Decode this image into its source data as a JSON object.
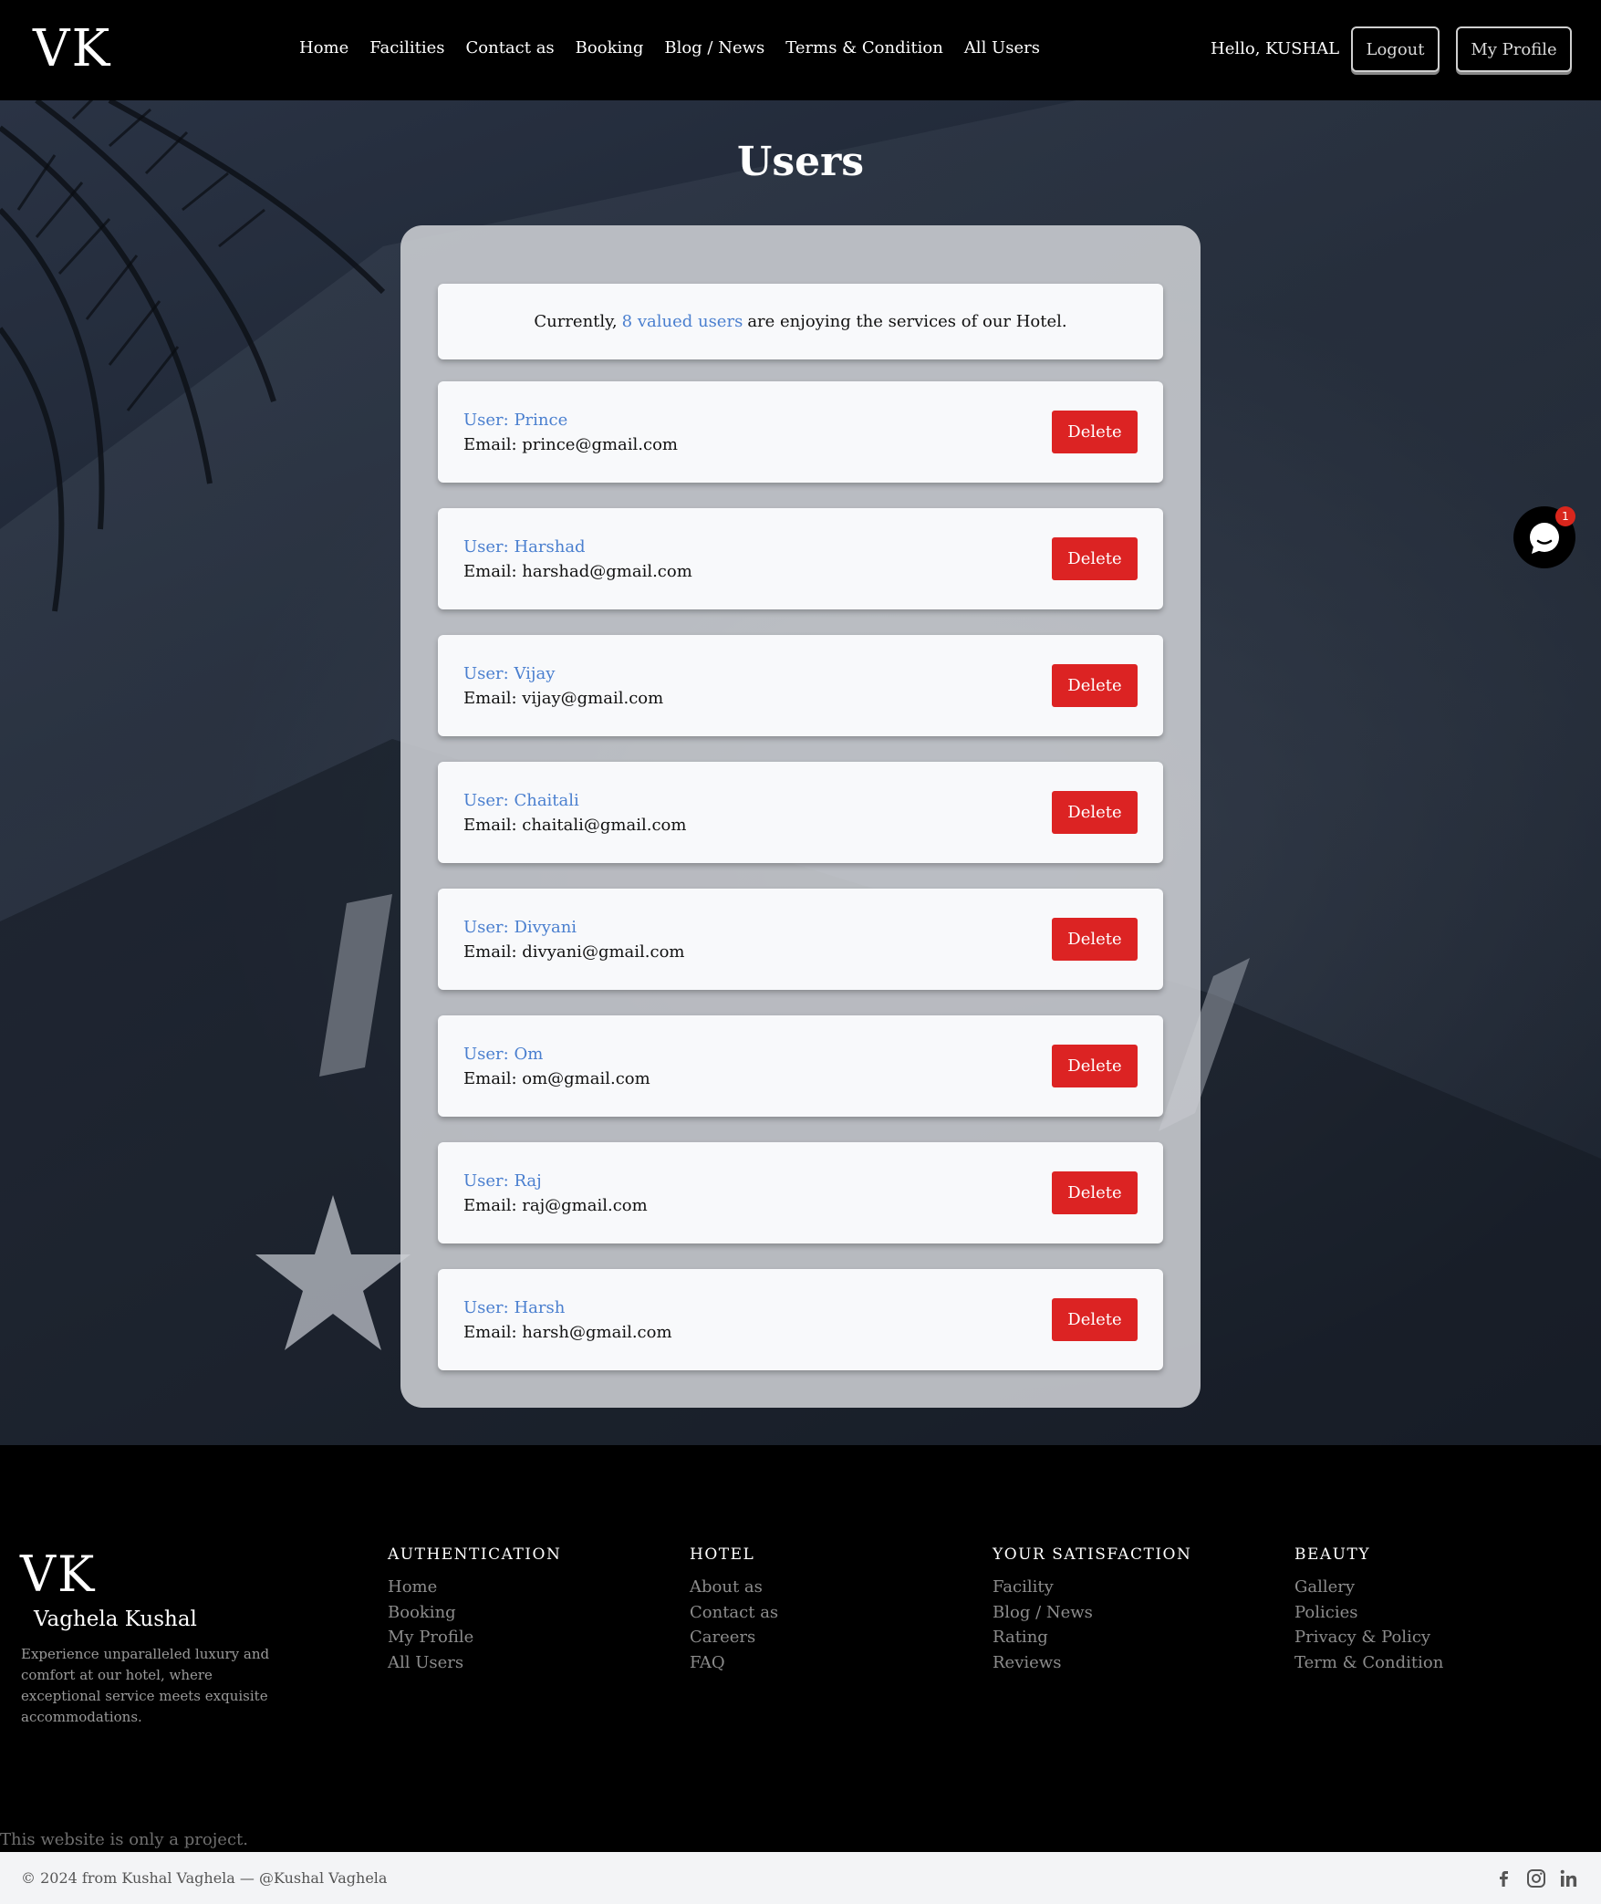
{
  "navbar": {
    "brand": "VK",
    "links": [
      "Home",
      "Facilities",
      "Contact as",
      "Booking",
      "Blog / News",
      "Terms & Condition",
      "All Users"
    ],
    "greeting": "Hello, KUSHAL",
    "logout_label": "Logout",
    "profile_label": "My Profile"
  },
  "main": {
    "title": "Users",
    "summary": {
      "prefix": "Currently,",
      "highlight": "8 valued users",
      "suffix": "are enjoying the services of our Hotel."
    },
    "delete_label": "Delete",
    "users": [
      {
        "name": "User: Prince",
        "email": "Email: prince@gmail.com"
      },
      {
        "name": "User: Harshad",
        "email": "Email: harshad@gmail.com"
      },
      {
        "name": "User: Vijay",
        "email": "Email: vijay@gmail.com"
      },
      {
        "name": "User: Chaitali",
        "email": "Email: chaitali@gmail.com"
      },
      {
        "name": "User: Divyani",
        "email": "Email: divyani@gmail.com"
      },
      {
        "name": "User: Om",
        "email": "Email: om@gmail.com"
      },
      {
        "name": "User: Raj",
        "email": "Email: raj@gmail.com"
      },
      {
        "name": "User: Harsh",
        "email": "Email: harsh@gmail.com"
      }
    ],
    "chat_badge": "1"
  },
  "footer": {
    "brand": "VK",
    "name": "Vaghela Kushal",
    "description": "Experience unparalleled luxury and comfort at our hotel, where exceptional service meets exquisite accommodations.",
    "columns": [
      {
        "heading": "AUTHENTICATION",
        "links": [
          "Home",
          "Booking",
          "My Profile",
          "All Users"
        ]
      },
      {
        "heading": "HOTEL",
        "links": [
          "About as",
          "Contact as",
          "Careers",
          "FAQ"
        ]
      },
      {
        "heading": "YOUR SATISFACTION",
        "links": [
          "Facility",
          "Blog / News",
          "Rating",
          "Reviews"
        ]
      },
      {
        "heading": "BEAUTY",
        "links": [
          "Gallery",
          "Policies",
          "Privacy & Policy",
          "Term & Condition"
        ]
      }
    ],
    "disclaimer": "This website is only a project.",
    "copyright": "© 2024 from Kushal Vaghela — @Kushal Vaghela",
    "social_icons": [
      "facebook-icon",
      "instagram-icon",
      "linkedin-icon"
    ]
  },
  "colors": {
    "accent_blue": "#4a7fcf",
    "delete_red": "#dc2323",
    "nav_bg": "#000000"
  }
}
